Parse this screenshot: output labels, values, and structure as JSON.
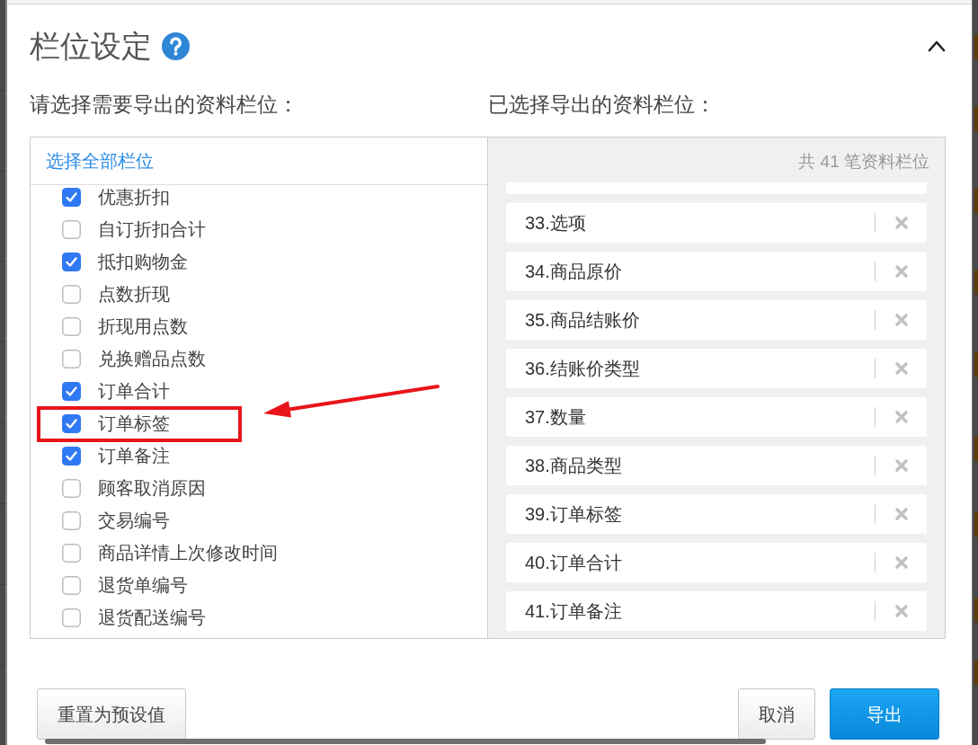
{
  "dialog": {
    "title": "栏位设定"
  },
  "available": {
    "label": "请选择需要导出的资料栏位：",
    "select_all": "选择全部栏位",
    "items": [
      {
        "label": "优惠折扣",
        "checked": true,
        "highlighted": false
      },
      {
        "label": "自订折扣合计",
        "checked": false,
        "highlighted": false
      },
      {
        "label": "抵扣购物金",
        "checked": true,
        "highlighted": false
      },
      {
        "label": "点数折现",
        "checked": false,
        "highlighted": false
      },
      {
        "label": "折现用点数",
        "checked": false,
        "highlighted": false
      },
      {
        "label": "兑换赠品点数",
        "checked": false,
        "highlighted": false
      },
      {
        "label": "订单合计",
        "checked": true,
        "highlighted": false
      },
      {
        "label": "订单标签",
        "checked": true,
        "highlighted": true
      },
      {
        "label": "订单备注",
        "checked": true,
        "highlighted": false
      },
      {
        "label": "顾客取消原因",
        "checked": false,
        "highlighted": false
      },
      {
        "label": "交易编号",
        "checked": false,
        "highlighted": false
      },
      {
        "label": "商品详情上次修改时间",
        "checked": false,
        "highlighted": false
      },
      {
        "label": "退货单编号",
        "checked": false,
        "highlighted": false
      },
      {
        "label": "退货配送编号",
        "checked": false,
        "highlighted": false
      }
    ]
  },
  "selected": {
    "label": "已选择导出的资料栏位：",
    "count": "共 41 笔资料栏位",
    "items": [
      "33.选项",
      "34.商品原价",
      "35.商品结账价",
      "36.结账价类型",
      "37.数量",
      "38.商品类型",
      "39.订单标签",
      "40.订单合计",
      "41.订单备注"
    ]
  },
  "buttons": [
    {
      "label": "重置为预设值",
      "kind": "default"
    },
    {
      "label": "取消",
      "kind": "default"
    },
    {
      "label": "导出",
      "kind": "primary"
    }
  ]
}
